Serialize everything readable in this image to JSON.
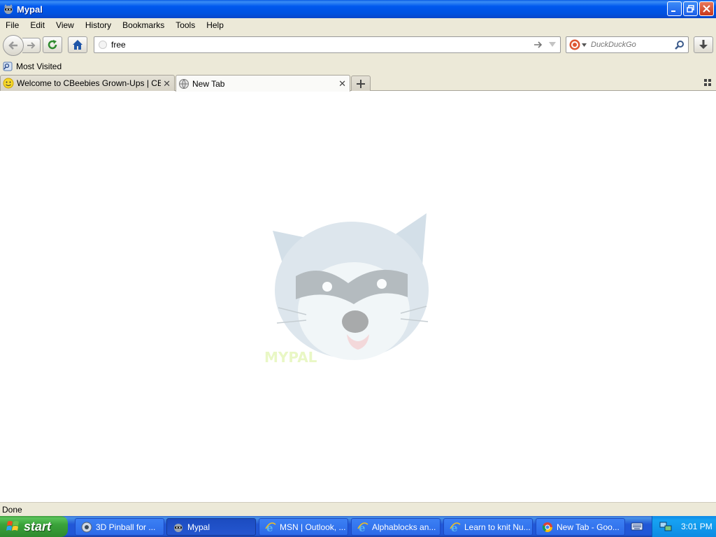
{
  "window": {
    "title": "Mypal"
  },
  "menu": {
    "items": [
      "File",
      "Edit",
      "View",
      "History",
      "Bookmarks",
      "Tools",
      "Help"
    ]
  },
  "navbar": {
    "url_value": "free",
    "search_placeholder": "DuckDuckGo"
  },
  "bookmarks": {
    "most_visited": "Most Visited"
  },
  "tabs": [
    {
      "title": "Welcome to CBeebies Grown-Ups | CBee...",
      "active": false
    },
    {
      "title": "New Tab",
      "active": true
    }
  ],
  "content": {
    "logo_text": "MYPAL"
  },
  "status": {
    "text": "Done"
  },
  "taskbar": {
    "start_label": "start",
    "items": [
      {
        "label": "3D Pinball for ...",
        "icon": "pinball-icon",
        "active": false
      },
      {
        "label": "Mypal",
        "icon": "mypal-icon",
        "active": true
      },
      {
        "label": "MSN | Outlook, ...",
        "icon": "ie-icon",
        "active": false
      },
      {
        "label": "Alphablocks an...",
        "icon": "ie-icon",
        "active": false
      },
      {
        "label": "Learn to knit Nu...",
        "icon": "ie-icon",
        "active": false
      },
      {
        "label": "New Tab - Goo...",
        "icon": "chrome-icon",
        "active": false
      }
    ],
    "clock": "3:01 PM"
  },
  "colors": {
    "title_bar": "#0058ee",
    "taskbar": "#2157d7",
    "start_button": "#3aa33a",
    "tray": "#0f8ae6"
  }
}
